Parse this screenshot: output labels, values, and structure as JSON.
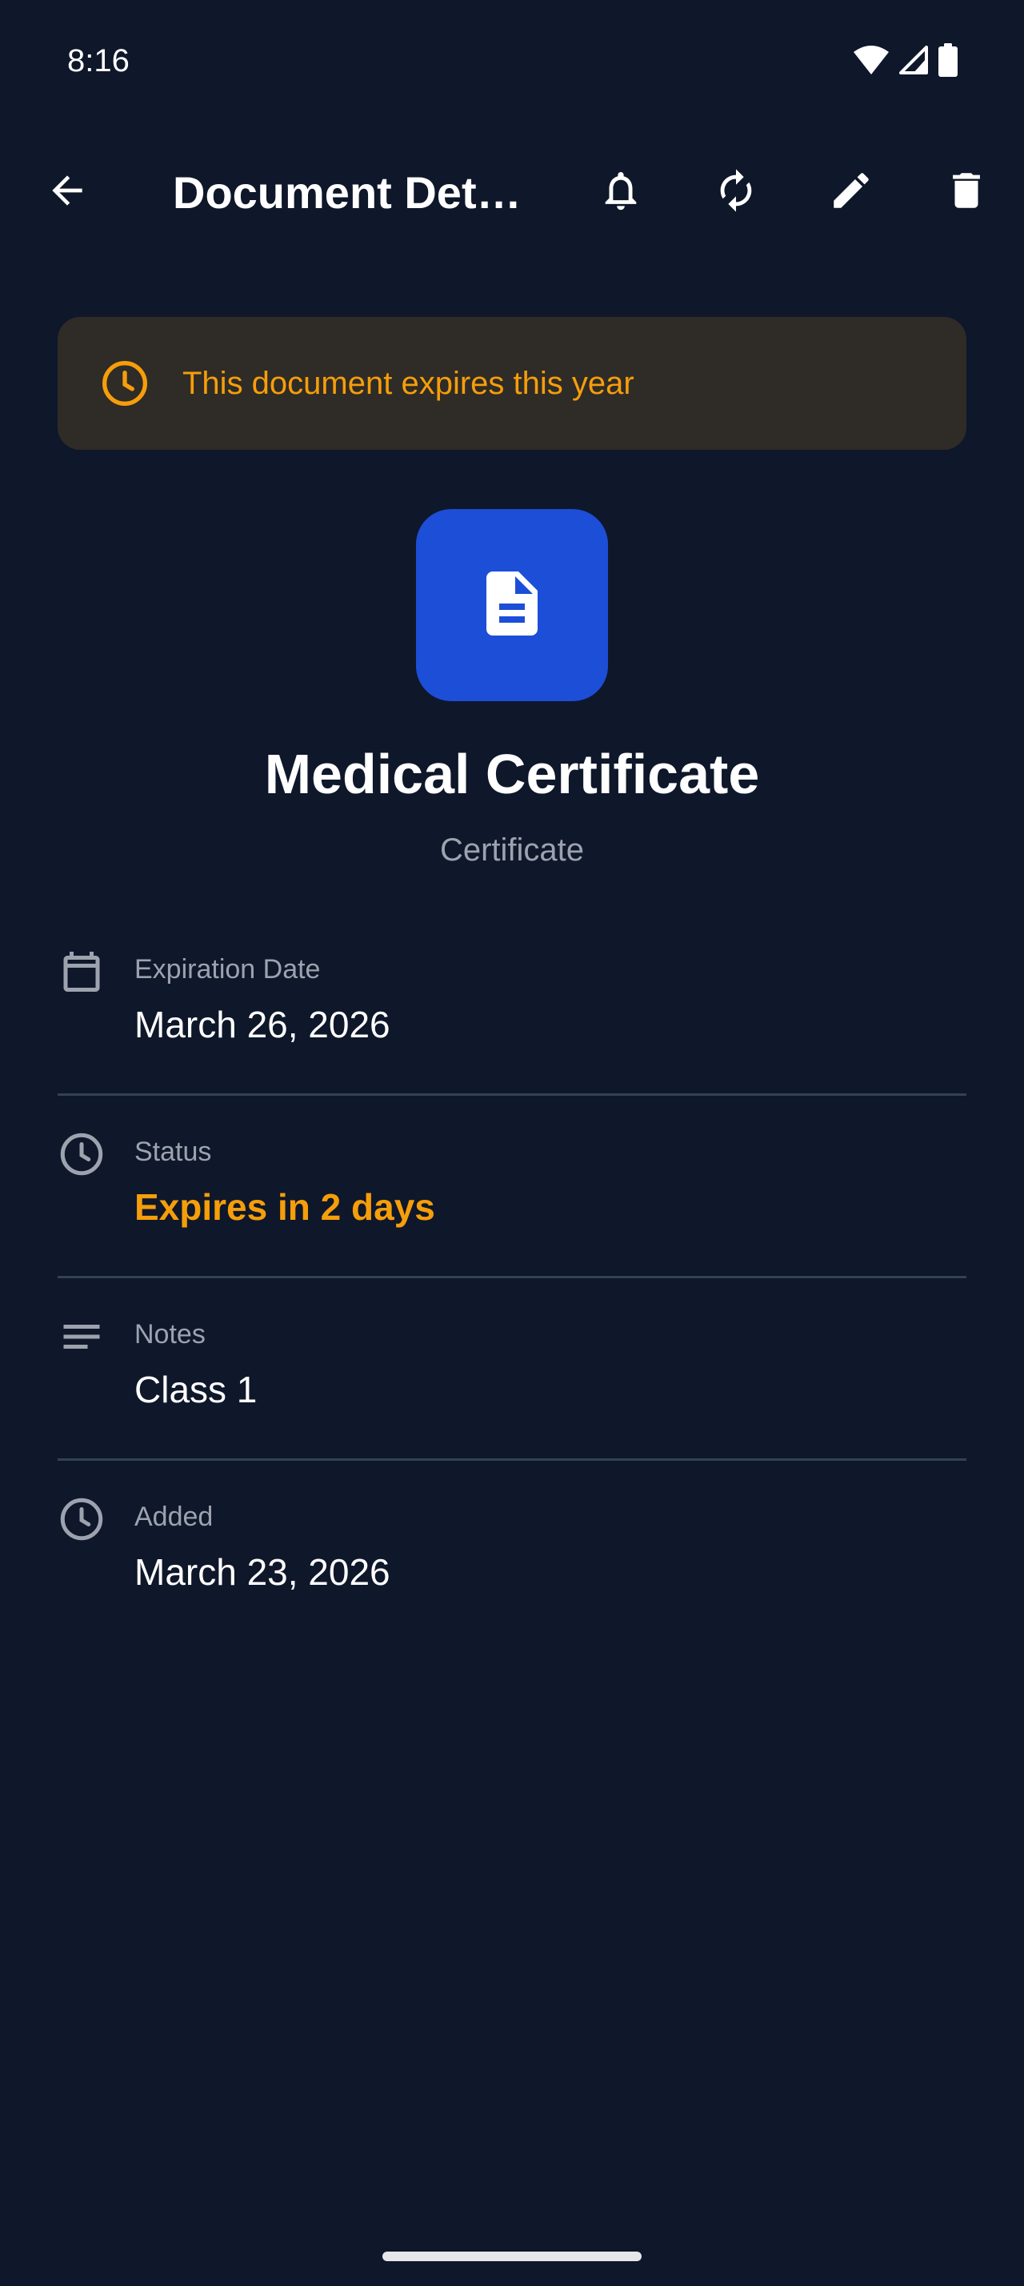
{
  "status_bar": {
    "time": "8:16",
    "icons": [
      "wifi-icon",
      "signal-icon",
      "battery-icon"
    ]
  },
  "app_bar": {
    "title": "Document Det…",
    "actions": [
      "back-arrow-icon",
      "bell-icon",
      "renew-icon",
      "edit-icon",
      "delete-icon"
    ]
  },
  "banner": {
    "text": "This document expires this year",
    "icon": "clock-icon",
    "color": "#f59e0b",
    "background": "#2f2b27"
  },
  "document": {
    "title": "Medical Certificate",
    "category": "Certificate",
    "icon": "document-icon",
    "tile_color": "#1d4ed8"
  },
  "details": [
    {
      "icon": "calendar-icon",
      "label": "Expiration Date",
      "value": "March 26, 2026"
    },
    {
      "icon": "clock-icon",
      "label": "Status",
      "value": "Expires in 2 days",
      "value_color": "#f59e0b"
    },
    {
      "icon": "notes-icon",
      "label": "Notes",
      "value": "Class 1"
    },
    {
      "icon": "clock-icon",
      "label": "Added",
      "value": "March 23, 2026"
    }
  ],
  "theme": {
    "background": "#0f172a",
    "accent_warning": "#f59e0b",
    "accent_primary": "#1d4ed8"
  }
}
